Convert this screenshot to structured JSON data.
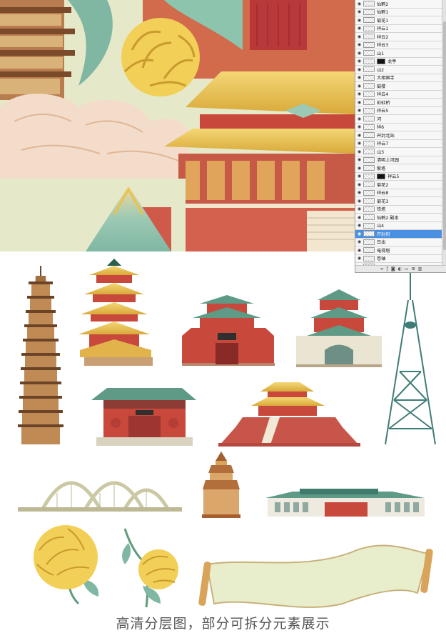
{
  "layers_panel": {
    "layers": [
      {
        "name": "仙鹤2",
        "mask": false,
        "selected": false
      },
      {
        "name": "仙鹤1",
        "mask": false,
        "selected": false
      },
      {
        "name": "菊花1",
        "mask": false,
        "selected": false
      },
      {
        "name": "祥云1",
        "mask": false,
        "selected": false
      },
      {
        "name": "祥云2",
        "mask": false,
        "selected": false
      },
      {
        "name": "祥云3",
        "mask": false,
        "selected": false
      },
      {
        "name": "山1",
        "mask": false,
        "selected": false
      },
      {
        "name": "龙亭",
        "mask": true,
        "selected": false
      },
      {
        "name": "山2",
        "mask": false,
        "selected": false
      },
      {
        "name": "大相国寺",
        "mask": false,
        "selected": false
      },
      {
        "name": "鼓楼",
        "mask": false,
        "selected": false
      },
      {
        "name": "祥云4",
        "mask": false,
        "selected": false
      },
      {
        "name": "彩虹桥",
        "mask": false,
        "selected": false
      },
      {
        "name": "祥云5",
        "mask": false,
        "selected": false
      },
      {
        "name": "河",
        "mask": false,
        "selected": false
      },
      {
        "name": "祥6",
        "mask": false,
        "selected": false
      },
      {
        "name": "开封北站",
        "mask": false,
        "selected": false
      },
      {
        "name": "祥云7",
        "mask": false,
        "selected": false
      },
      {
        "name": "山3",
        "mask": false,
        "selected": false
      },
      {
        "name": "清明上河园",
        "mask": false,
        "selected": false
      },
      {
        "name": "繁塔",
        "mask": false,
        "selected": false
      },
      {
        "name": "祥云5",
        "mask": true,
        "selected": false
      },
      {
        "name": "菊花2",
        "mask": false,
        "selected": false
      },
      {
        "name": "祥云8",
        "mask": false,
        "selected": false
      },
      {
        "name": "菊花3",
        "mask": false,
        "selected": false
      },
      {
        "name": "铁塔",
        "mask": false,
        "selected": false
      },
      {
        "name": "仙鹤2 副本",
        "mask": false,
        "selected": false
      },
      {
        "name": "山4",
        "mask": false,
        "selected": false
      },
      {
        "name": "开封府",
        "mask": false,
        "selected": true
      },
      {
        "name": "日出",
        "mask": false,
        "selected": false
      },
      {
        "name": "电视塔",
        "mask": false,
        "selected": false
      },
      {
        "name": "卷轴",
        "mask": false,
        "selected": false
      },
      {
        "name": "云",
        "mask": false,
        "selected": false
      }
    ],
    "footer_icons": [
      "link-icon",
      "fx-icon",
      "mask-icon",
      "adjust-icon",
      "folder-icon",
      "new-layer-icon",
      "trash-icon"
    ]
  },
  "caption": "高清分层图，部分可拆分元素展示",
  "colors": {
    "gold": "#e9c24a",
    "red_wall": "#c8483b",
    "teal_roof": "#5e9a86",
    "cream_cloud": "#f4e2d2",
    "selected_layer": "#4a90e2"
  }
}
